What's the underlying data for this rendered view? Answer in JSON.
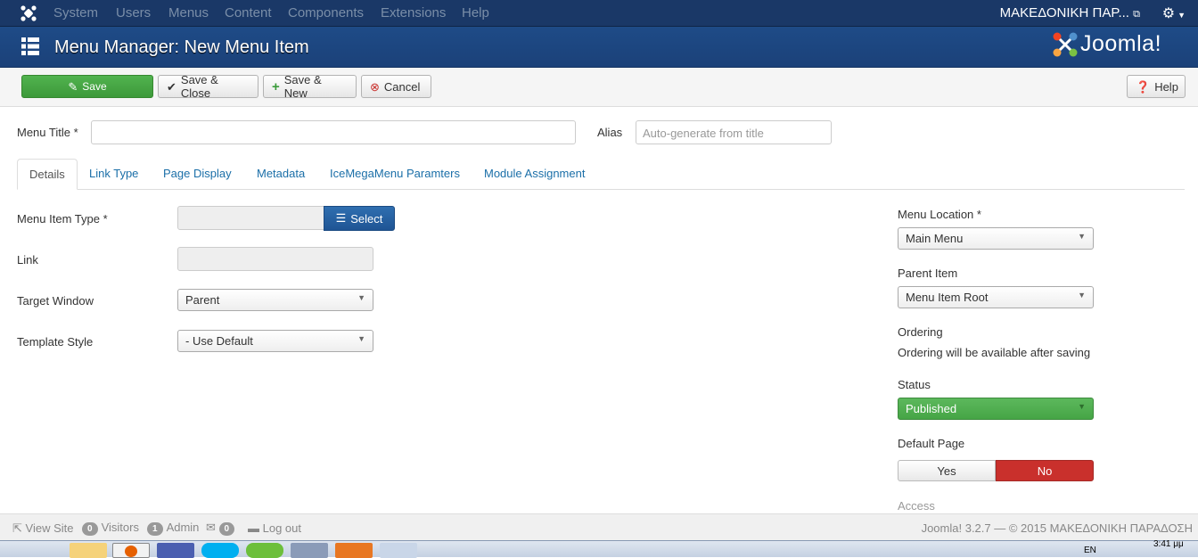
{
  "topnav": {
    "items": [
      "System",
      "Users",
      "Menus",
      "Content",
      "Components",
      "Extensions",
      "Help"
    ],
    "site_name": "ΜΑΚΕΔΟΝΙΚΗ ΠΑΡ..."
  },
  "header": {
    "title": "Menu Manager: New Menu Item",
    "brand": "Joomla!"
  },
  "toolbar": {
    "save": "Save",
    "save_close": "Save & Close",
    "save_new": "Save & New",
    "cancel": "Cancel",
    "help": "Help"
  },
  "form": {
    "menu_title_label": "Menu Title *",
    "menu_title_value": "",
    "alias_label": "Alias",
    "alias_placeholder": "Auto-generate from title"
  },
  "tabs": [
    "Details",
    "Link Type",
    "Page Display",
    "Metadata",
    "IceMegaMenu Paramters",
    "Module Assignment"
  ],
  "details": {
    "menu_item_type_label": "Menu Item Type *",
    "select_button": "Select",
    "link_label": "Link",
    "target_window_label": "Target Window",
    "target_window_value": "Parent",
    "template_style_label": "Template Style",
    "template_style_value": "- Use Default"
  },
  "sidebar": {
    "menu_location_label": "Menu Location *",
    "menu_location_value": "Main Menu",
    "parent_item_label": "Parent Item",
    "parent_item_value": "Menu Item Root",
    "ordering_label": "Ordering",
    "ordering_note": "Ordering will be available after saving",
    "status_label": "Status",
    "status_value": "Published",
    "default_page_label": "Default Page",
    "default_yes": "Yes",
    "default_no": "No",
    "access_label": "Access"
  },
  "statusbar": {
    "view_site": "View Site",
    "visitors_count": "0",
    "visitors_label": "Visitors",
    "admin_count": "1",
    "admin_label": "Admin",
    "messages_count": "0",
    "logout": "Log out",
    "footer": "Joomla! 3.2.7 — © 2015 ΜΑΚΕΔΟΝΙΚΗ ΠΑΡΑΔΟΣΗ"
  },
  "taskbar": {
    "lang": "EN",
    "clock": "3:41 μμ"
  },
  "colors": {
    "nav_bg": "#1a3867",
    "header_bg": "#1e4b87",
    "save_green": "#46a546",
    "published_green": "#46a546",
    "no_red": "#c9302c",
    "link_blue": "#1b6fa8"
  }
}
